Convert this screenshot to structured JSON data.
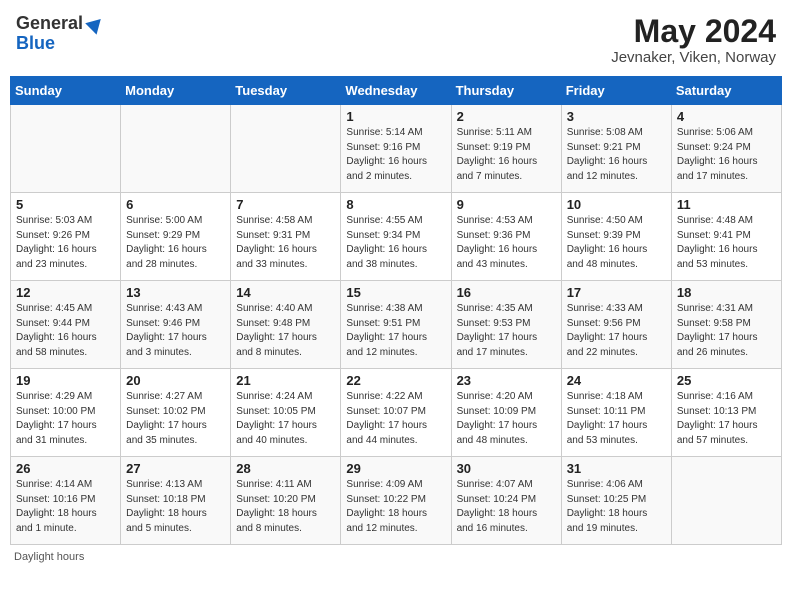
{
  "header": {
    "logo_general": "General",
    "logo_blue": "Blue",
    "month_title": "May 2024",
    "location": "Jevnaker, Viken, Norway"
  },
  "weekdays": [
    "Sunday",
    "Monday",
    "Tuesday",
    "Wednesday",
    "Thursday",
    "Friday",
    "Saturday"
  ],
  "weeks": [
    [
      {
        "num": "",
        "info": ""
      },
      {
        "num": "",
        "info": ""
      },
      {
        "num": "",
        "info": ""
      },
      {
        "num": "1",
        "info": "Sunrise: 5:14 AM\nSunset: 9:16 PM\nDaylight: 16 hours\nand 2 minutes."
      },
      {
        "num": "2",
        "info": "Sunrise: 5:11 AM\nSunset: 9:19 PM\nDaylight: 16 hours\nand 7 minutes."
      },
      {
        "num": "3",
        "info": "Sunrise: 5:08 AM\nSunset: 9:21 PM\nDaylight: 16 hours\nand 12 minutes."
      },
      {
        "num": "4",
        "info": "Sunrise: 5:06 AM\nSunset: 9:24 PM\nDaylight: 16 hours\nand 17 minutes."
      }
    ],
    [
      {
        "num": "5",
        "info": "Sunrise: 5:03 AM\nSunset: 9:26 PM\nDaylight: 16 hours\nand 23 minutes."
      },
      {
        "num": "6",
        "info": "Sunrise: 5:00 AM\nSunset: 9:29 PM\nDaylight: 16 hours\nand 28 minutes."
      },
      {
        "num": "7",
        "info": "Sunrise: 4:58 AM\nSunset: 9:31 PM\nDaylight: 16 hours\nand 33 minutes."
      },
      {
        "num": "8",
        "info": "Sunrise: 4:55 AM\nSunset: 9:34 PM\nDaylight: 16 hours\nand 38 minutes."
      },
      {
        "num": "9",
        "info": "Sunrise: 4:53 AM\nSunset: 9:36 PM\nDaylight: 16 hours\nand 43 minutes."
      },
      {
        "num": "10",
        "info": "Sunrise: 4:50 AM\nSunset: 9:39 PM\nDaylight: 16 hours\nand 48 minutes."
      },
      {
        "num": "11",
        "info": "Sunrise: 4:48 AM\nSunset: 9:41 PM\nDaylight: 16 hours\nand 53 minutes."
      }
    ],
    [
      {
        "num": "12",
        "info": "Sunrise: 4:45 AM\nSunset: 9:44 PM\nDaylight: 16 hours\nand 58 minutes."
      },
      {
        "num": "13",
        "info": "Sunrise: 4:43 AM\nSunset: 9:46 PM\nDaylight: 17 hours\nand 3 minutes."
      },
      {
        "num": "14",
        "info": "Sunrise: 4:40 AM\nSunset: 9:48 PM\nDaylight: 17 hours\nand 8 minutes."
      },
      {
        "num": "15",
        "info": "Sunrise: 4:38 AM\nSunset: 9:51 PM\nDaylight: 17 hours\nand 12 minutes."
      },
      {
        "num": "16",
        "info": "Sunrise: 4:35 AM\nSunset: 9:53 PM\nDaylight: 17 hours\nand 17 minutes."
      },
      {
        "num": "17",
        "info": "Sunrise: 4:33 AM\nSunset: 9:56 PM\nDaylight: 17 hours\nand 22 minutes."
      },
      {
        "num": "18",
        "info": "Sunrise: 4:31 AM\nSunset: 9:58 PM\nDaylight: 17 hours\nand 26 minutes."
      }
    ],
    [
      {
        "num": "19",
        "info": "Sunrise: 4:29 AM\nSunset: 10:00 PM\nDaylight: 17 hours\nand 31 minutes."
      },
      {
        "num": "20",
        "info": "Sunrise: 4:27 AM\nSunset: 10:02 PM\nDaylight: 17 hours\nand 35 minutes."
      },
      {
        "num": "21",
        "info": "Sunrise: 4:24 AM\nSunset: 10:05 PM\nDaylight: 17 hours\nand 40 minutes."
      },
      {
        "num": "22",
        "info": "Sunrise: 4:22 AM\nSunset: 10:07 PM\nDaylight: 17 hours\nand 44 minutes."
      },
      {
        "num": "23",
        "info": "Sunrise: 4:20 AM\nSunset: 10:09 PM\nDaylight: 17 hours\nand 48 minutes."
      },
      {
        "num": "24",
        "info": "Sunrise: 4:18 AM\nSunset: 10:11 PM\nDaylight: 17 hours\nand 53 minutes."
      },
      {
        "num": "25",
        "info": "Sunrise: 4:16 AM\nSunset: 10:13 PM\nDaylight: 17 hours\nand 57 minutes."
      }
    ],
    [
      {
        "num": "26",
        "info": "Sunrise: 4:14 AM\nSunset: 10:16 PM\nDaylight: 18 hours\nand 1 minute."
      },
      {
        "num": "27",
        "info": "Sunrise: 4:13 AM\nSunset: 10:18 PM\nDaylight: 18 hours\nand 5 minutes."
      },
      {
        "num": "28",
        "info": "Sunrise: 4:11 AM\nSunset: 10:20 PM\nDaylight: 18 hours\nand 8 minutes."
      },
      {
        "num": "29",
        "info": "Sunrise: 4:09 AM\nSunset: 10:22 PM\nDaylight: 18 hours\nand 12 minutes."
      },
      {
        "num": "30",
        "info": "Sunrise: 4:07 AM\nSunset: 10:24 PM\nDaylight: 18 hours\nand 16 minutes."
      },
      {
        "num": "31",
        "info": "Sunrise: 4:06 AM\nSunset: 10:25 PM\nDaylight: 18 hours\nand 19 minutes."
      },
      {
        "num": "",
        "info": ""
      }
    ]
  ],
  "footer": {
    "daylight_label": "Daylight hours"
  }
}
